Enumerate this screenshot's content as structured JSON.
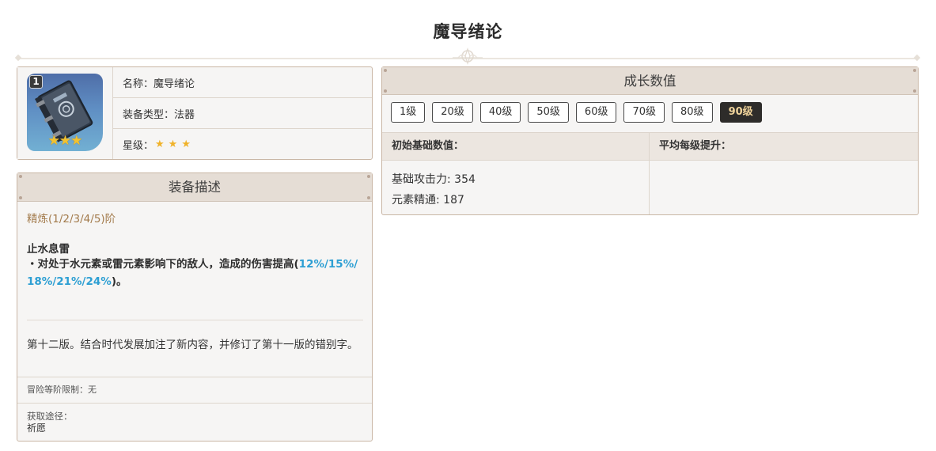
{
  "page": {
    "title": "魔导绪论"
  },
  "info": {
    "refinement_badge": "1",
    "icon_stars": "★★★",
    "name_label": "名称：",
    "name_value": "魔导绪论",
    "type_label": "装备类型：",
    "type_value": "法器",
    "rarity_label": "星级：",
    "rarity_stars": "★★★",
    "rarity_count": 3
  },
  "description": {
    "header": "装备描述",
    "refine_range": "精炼(1/2/3/4/5)阶",
    "passive_name": "止水息雷",
    "passive_text_prefix": "・对处于水元素或雷元素影响下的敌人，造成的伤害提高(",
    "passive_values": "12%/15%/18%/21%/24%",
    "passive_text_suffix": ")。",
    "lore": "第十二版。结合时代发展加注了新内容，并修订了第十一版的错别字。",
    "limit": "冒险等阶限制：无",
    "source_label": "获取途径：",
    "source_value": "祈愿"
  },
  "growth": {
    "header": "成长数值",
    "levels": [
      "1级",
      "20级",
      "40级",
      "50级",
      "60级",
      "70级",
      "80级",
      "90级"
    ],
    "active_level": "90级",
    "col_base": "初始基础数值：",
    "col_growth": "平均每级提升：",
    "base_stat_1": "基础攻击力: 354",
    "base_stat_2": "元素精通: 187"
  },
  "colors": {
    "accent_gold": "#a37b4c",
    "highlight_blue": "#2d9fd3",
    "star_gold": "#f0b229",
    "active_tab_bg": "#2e2c2a",
    "active_tab_text": "#f1d49b"
  }
}
